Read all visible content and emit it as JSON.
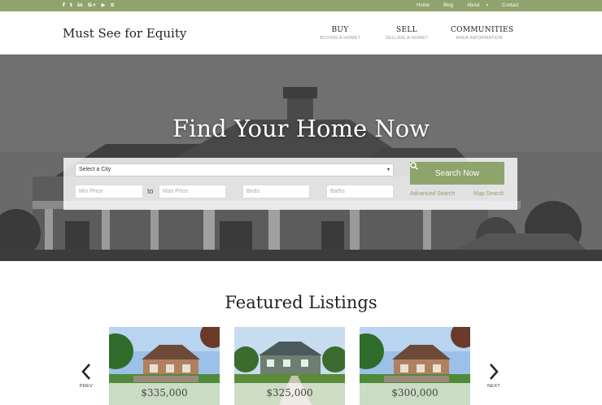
{
  "topbar": {
    "social": [
      {
        "icon": "facebook-icon",
        "glyph": "f"
      },
      {
        "icon": "twitter-icon",
        "glyph": "t"
      },
      {
        "icon": "linkedin-icon",
        "glyph": "in"
      },
      {
        "icon": "google-plus-icon",
        "glyph": "G+"
      },
      {
        "icon": "youtube-icon",
        "glyph": "▶"
      },
      {
        "icon": "rss-icon",
        "glyph": "≋"
      }
    ],
    "links": {
      "home": "Home",
      "blog": "Blog",
      "about": "About",
      "contact": "Contact"
    }
  },
  "header": {
    "logo": "Must See for Equity",
    "nav": [
      {
        "title": "BUY",
        "sub": "BUYING A HOME?"
      },
      {
        "title": "SELL",
        "sub": "SELLING A HOME?"
      },
      {
        "title": "COMMUNITIES",
        "sub": "AREA INFORMATION"
      }
    ]
  },
  "hero": {
    "title": "Find Your Home Now",
    "search": {
      "city_select": "Select a City",
      "min_price": "Min Price",
      "to": "to",
      "max_price": "Max Price",
      "beds": "Beds",
      "baths": "Baths",
      "button": "Search Now",
      "advanced": "Advanced Search",
      "map": "Map Search"
    }
  },
  "featured": {
    "title": "Featured Listings",
    "prev": "PREV",
    "next": "NEXT",
    "listings": [
      {
        "price": "$335,000"
      },
      {
        "price": "$325,000"
      },
      {
        "price": "$300,000"
      }
    ]
  },
  "colors": {
    "accent": "#8fa46d",
    "hero_overlay": "#5a5a5a"
  }
}
